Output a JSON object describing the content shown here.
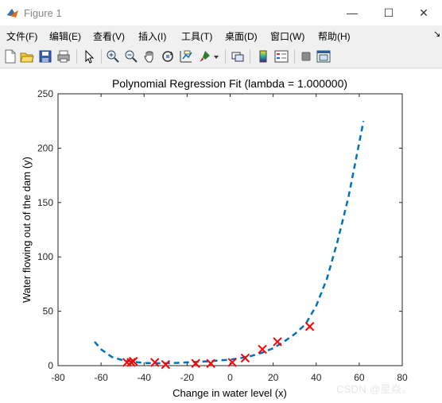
{
  "window": {
    "title": "Figure 1",
    "controls": {
      "minimize": "—",
      "maximize": "☐",
      "close": "✕"
    }
  },
  "menu": {
    "items": [
      "文件(F)",
      "编辑(E)",
      "查看(V)",
      "插入(I)",
      "工具(T)",
      "桌面(D)",
      "窗口(W)",
      "帮助(H)"
    ],
    "overflow": "↘"
  },
  "toolbar": {
    "icons": [
      "new-figure-icon",
      "open-file-icon",
      "save-icon",
      "print-icon",
      "select-arrow-icon",
      "zoom-in-icon",
      "zoom-out-icon",
      "pan-hand-icon",
      "rotate-3d-icon",
      "data-cursor-icon",
      "brush-icon",
      "link-plot-icon",
      "colorbar-icon",
      "legend-icon",
      "hide-plot-tools-icon",
      "show-plot-tools-icon"
    ]
  },
  "watermark": "CSDN @星焱。",
  "chart_data": {
    "type": "scatter",
    "title": "Polynomial Regression Fit (lambda = 1.000000)",
    "xlabel": "Change in water level (x)",
    "ylabel": "Water flowing out of the dam (y)",
    "xlim": [
      -80,
      80
    ],
    "ylim": [
      0,
      250
    ],
    "xticks": [
      -80,
      -60,
      -40,
      -20,
      0,
      20,
      40,
      60,
      80
    ],
    "yticks": [
      0,
      50,
      100,
      150,
      200,
      250
    ],
    "grid": false,
    "legend": null,
    "series": [
      {
        "kind": "points",
        "marker": "x",
        "color": "#ff0000",
        "x": [
          -48,
          -46,
          -45,
          -35,
          -30,
          -16,
          -9,
          1,
          7,
          15,
          22,
          37
        ],
        "y": [
          3,
          3,
          4,
          3,
          1,
          2,
          2,
          3,
          7,
          15,
          22,
          36
        ]
      },
      {
        "kind": "line",
        "style": "dashed",
        "color": "#0072bd",
        "x": [
          -63,
          -60,
          -55,
          -50,
          -45,
          -40,
          -35,
          -30,
          -25,
          -20,
          -15,
          -10,
          -5,
          0,
          5,
          10,
          15,
          20,
          25,
          30,
          35,
          40,
          45,
          50,
          55,
          60,
          62
        ],
        "y": [
          22,
          15,
          8,
          5,
          3.5,
          2.5,
          2.2,
          2.2,
          2.5,
          3,
          3.5,
          4,
          4.8,
          5.5,
          7,
          9,
          12,
          16,
          22,
          29,
          38,
          55,
          80,
          115,
          155,
          205,
          225
        ]
      }
    ]
  }
}
